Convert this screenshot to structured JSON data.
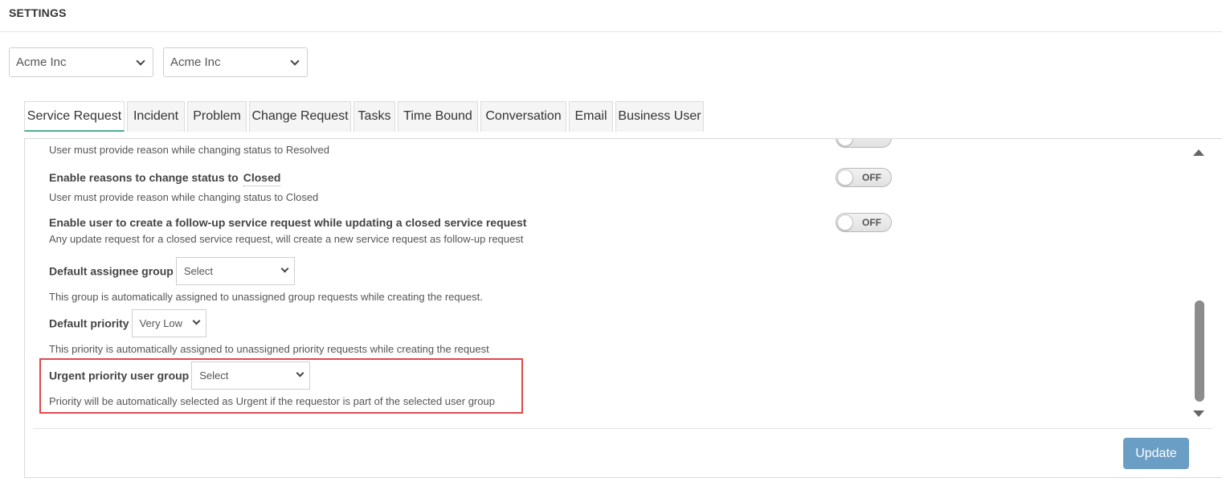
{
  "header": {
    "title": "SETTINGS"
  },
  "filters": {
    "account_select": "Acme Inc",
    "org_select": "Acme Inc"
  },
  "tabs": [
    {
      "label": "Service Request",
      "active": true
    },
    {
      "label": "Incident"
    },
    {
      "label": "Problem"
    },
    {
      "label": "Change Request"
    },
    {
      "label": "Tasks"
    },
    {
      "label": "Time Bound"
    },
    {
      "label": "Conversation"
    },
    {
      "label": "Email"
    },
    {
      "label": "Business User"
    }
  ],
  "settings": {
    "resolved_reason": {
      "desc": "User must provide reason while changing status to Resolved"
    },
    "closed_reason": {
      "title": "Enable reasons to change status to",
      "keyword": "Closed",
      "desc": "User must provide reason while changing status to Closed",
      "toggle": "OFF"
    },
    "follow_up": {
      "title": "Enable user to create a follow-up service request while updating a closed service request",
      "desc": "Any update request for a closed service request, will create a new service request as follow-up request",
      "toggle": "OFF"
    },
    "default_assignee_group": {
      "label": "Default assignee group",
      "value": "Select",
      "desc": "This group is automatically assigned to unassigned group requests while creating the request."
    },
    "default_priority": {
      "label": "Default priority",
      "value": "Very Low",
      "desc": "This priority is automatically assigned to unassigned priority requests while creating the request"
    },
    "urgent_priority_group": {
      "label": "Urgent priority user group",
      "value": "Select",
      "desc": "Priority will be automatically selected as Urgent if the requestor is part of the selected user group"
    }
  },
  "actions": {
    "update_label": "Update"
  },
  "colors": {
    "accent_tab": "#4caf91",
    "highlight": "#e0484c",
    "update_button": "#6a9ec4"
  },
  "icons": {
    "dropdown": "chevron-down-icon",
    "scroll_up": "arrow-up-icon",
    "scroll_down": "arrow-down-icon"
  }
}
